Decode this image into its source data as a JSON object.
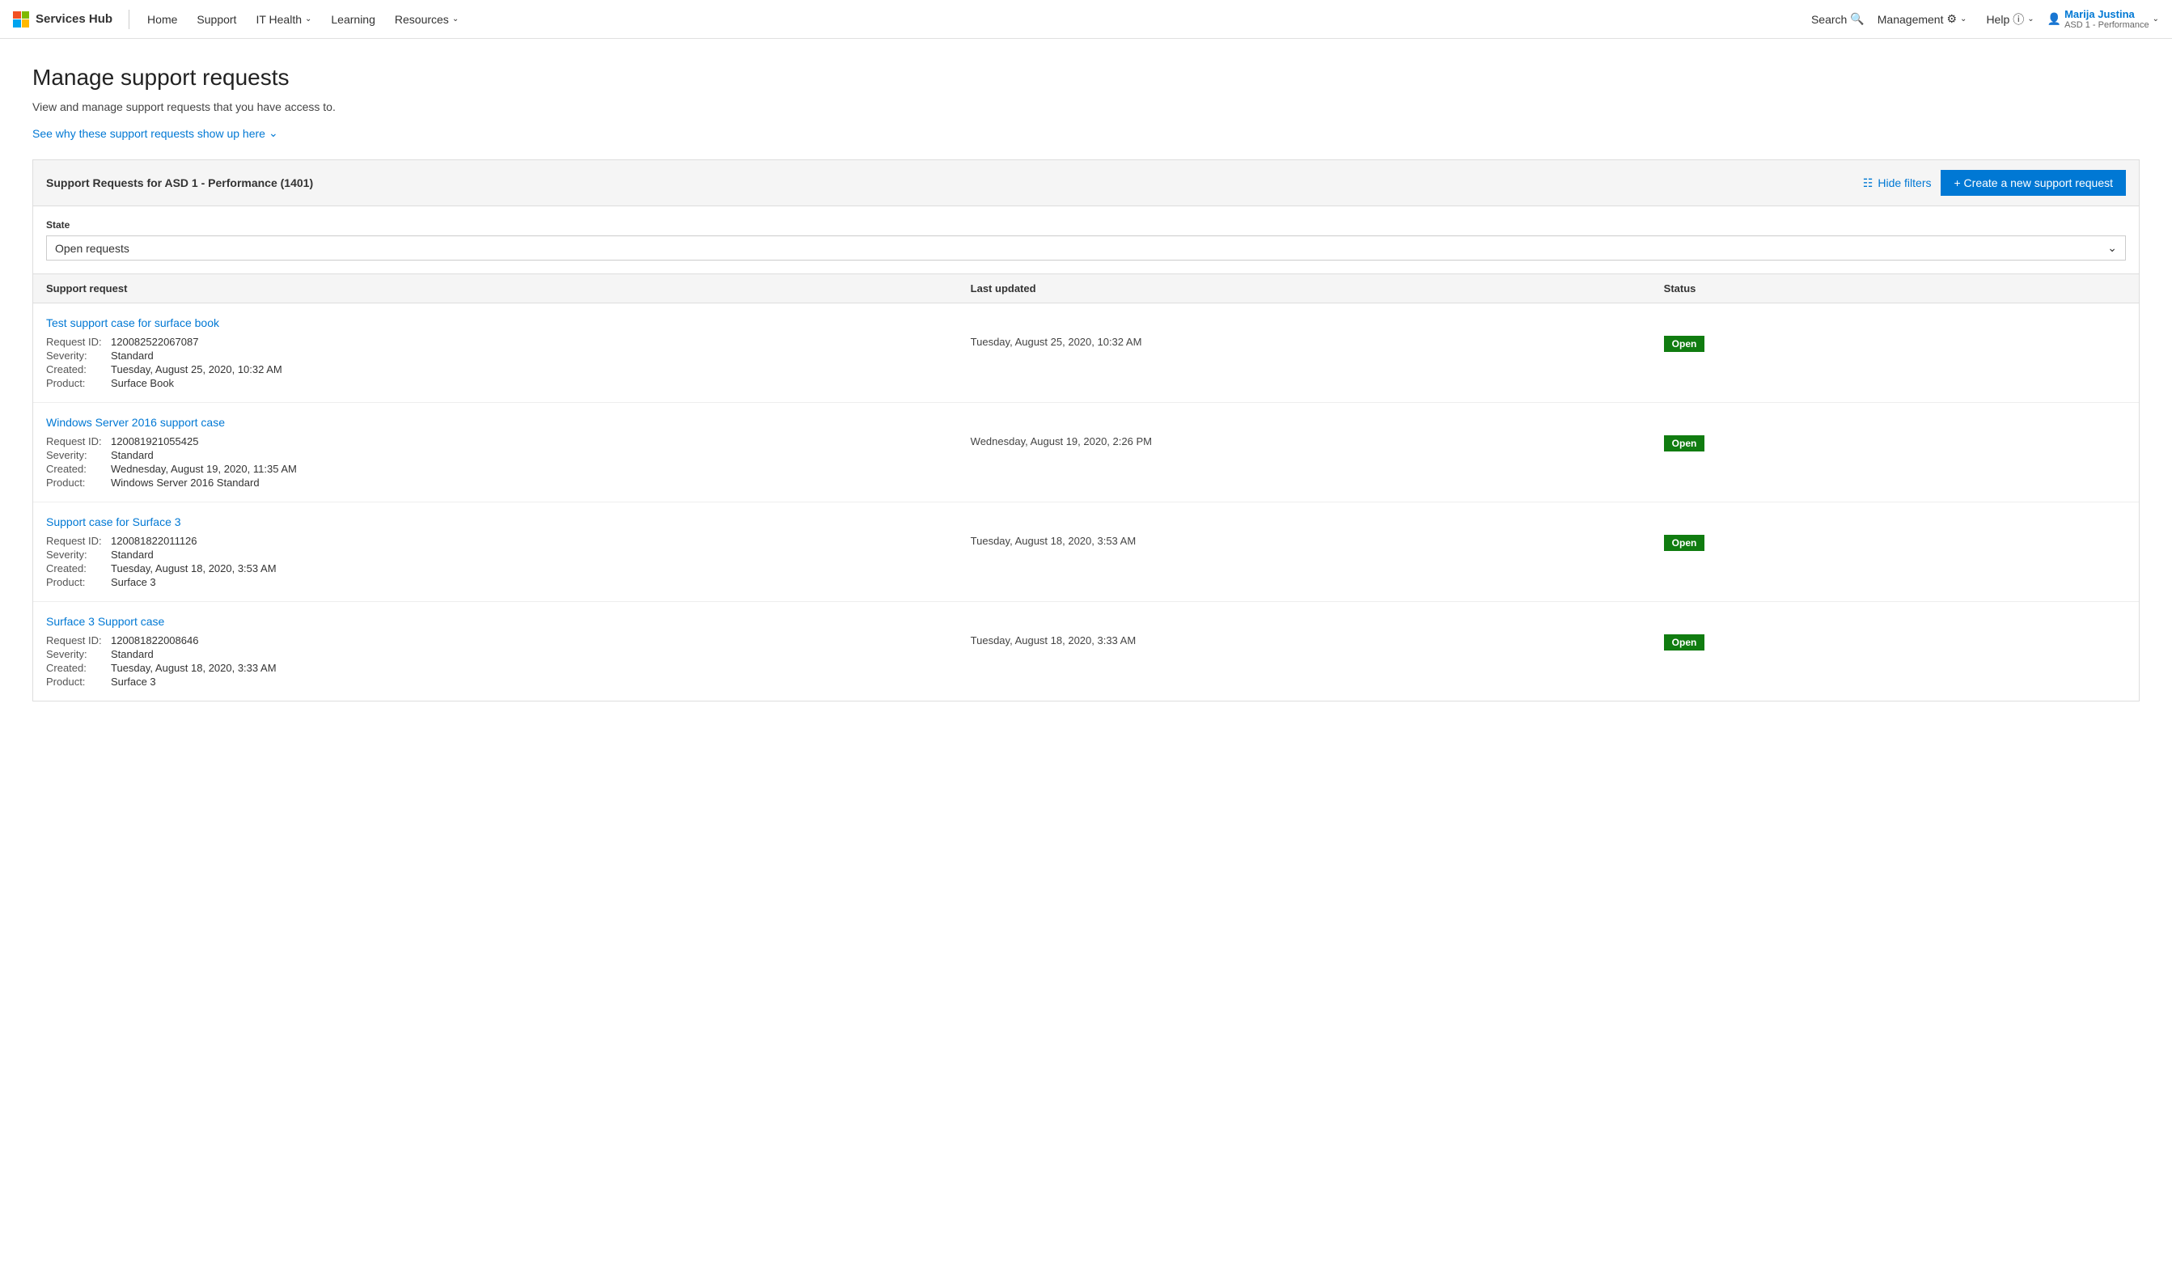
{
  "nav": {
    "brand": "Services Hub",
    "links": [
      {
        "label": "Home",
        "hasArrow": false
      },
      {
        "label": "Support",
        "hasArrow": false
      },
      {
        "label": "IT Health",
        "hasArrow": true
      },
      {
        "label": "Learning",
        "hasArrow": false
      },
      {
        "label": "Resources",
        "hasArrow": true
      }
    ],
    "search_label": "Search",
    "management_label": "Management",
    "help_label": "Help",
    "user_name": "Marija Justina",
    "user_sub": "ASD 1 - Performance"
  },
  "page": {
    "title": "Manage support requests",
    "subtitle": "View and manage support requests that you have access to.",
    "see_why": "See why these support requests show up here"
  },
  "panel": {
    "title": "Support Requests for ASD 1 - Performance (1401)",
    "hide_filters_label": "Hide filters",
    "create_label": "+ Create a new support request"
  },
  "filters": {
    "state_label": "State",
    "state_value": "Open requests"
  },
  "table": {
    "col_request": "Support request",
    "col_updated": "Last updated",
    "col_status": "Status"
  },
  "requests": [
    {
      "title": "Test support case for surface book",
      "request_id": "120082522067087",
      "severity": "Standard",
      "created": "Tuesday, August 25, 2020, 10:32 AM",
      "product": "Surface Book",
      "last_updated": "Tuesday, August 25, 2020, 10:32 AM",
      "status": "Open"
    },
    {
      "title": "Windows Server 2016 support case",
      "request_id": "120081921055425",
      "severity": "Standard",
      "created": "Wednesday, August 19, 2020, 11:35 AM",
      "product": "Windows Server 2016 Standard",
      "last_updated": "Wednesday, August 19, 2020, 2:26 PM",
      "status": "Open"
    },
    {
      "title": "Support case for Surface 3",
      "request_id": "120081822011126",
      "severity": "Standard",
      "created": "Tuesday, August 18, 2020, 3:53 AM",
      "product": "Surface 3",
      "last_updated": "Tuesday, August 18, 2020, 3:53 AM",
      "status": "Open"
    },
    {
      "title": "Surface 3 Support case",
      "request_id": "120081822008646",
      "severity": "Standard",
      "created": "Tuesday, August 18, 2020, 3:33 AM",
      "product": "Surface 3",
      "last_updated": "Tuesday, August 18, 2020, 3:33 AM",
      "status": "Open"
    }
  ],
  "labels": {
    "request_id": "Request ID:",
    "severity": "Severity:",
    "created": "Created:",
    "product": "Product:"
  }
}
